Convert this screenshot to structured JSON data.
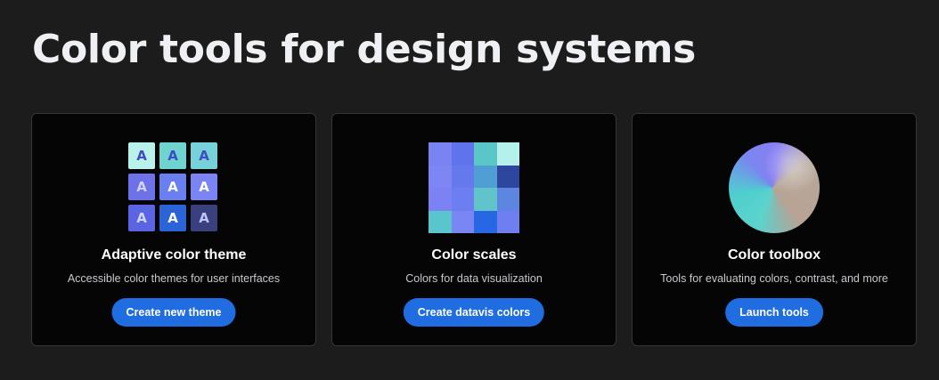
{
  "page": {
    "title": "Color tools for design systems"
  },
  "cards": [
    {
      "title": "Adaptive color theme",
      "description": "Accessible color themes for user interfaces",
      "button_label": "Create new theme",
      "icon": "adaptive-theme-grid",
      "grid_letter": "A",
      "grid_cells": [
        {
          "bg": "#b9f2ea",
          "fg": "#3e4cc4"
        },
        {
          "bg": "#6fd3cf",
          "fg": "#3e4cc4"
        },
        {
          "bg": "#77d1d9",
          "fg": "#3e4cc4"
        },
        {
          "bg": "#6e72e8",
          "fg": "#cfd4ff"
        },
        {
          "bg": "#6a7ff0",
          "fg": "#ffffff"
        },
        {
          "bg": "#7a84f4",
          "fg": "#ffffff"
        },
        {
          "bg": "#5b64e3",
          "fg": "#cfd8ff"
        },
        {
          "bg": "#2b63d9",
          "fg": "#ffffff"
        },
        {
          "bg": "#3a3f7e",
          "fg": "#bcc6ff"
        }
      ]
    },
    {
      "title": "Color scales",
      "description": "Colors for data visualization",
      "button_label": "Create datavis colors",
      "icon": "color-scales-grid",
      "grid_cells": [
        "#7a83f2",
        "#5f73ec",
        "#5bc6c7",
        "#b4f0ec",
        "#7d86f3",
        "#6479ec",
        "#4f9fd5",
        "#2d469e",
        "#7c82f3",
        "#6c7ef0",
        "#61c4cb",
        "#5d86e0",
        "#58c6cc",
        "#7a86f3",
        "#2867e3",
        "#6f7ff1"
      ]
    },
    {
      "title": "Color toolbox",
      "description": "Tools for evaluating colors, contrast, and more",
      "button_label": "Launch tools",
      "icon": "color-wheel"
    }
  ]
}
